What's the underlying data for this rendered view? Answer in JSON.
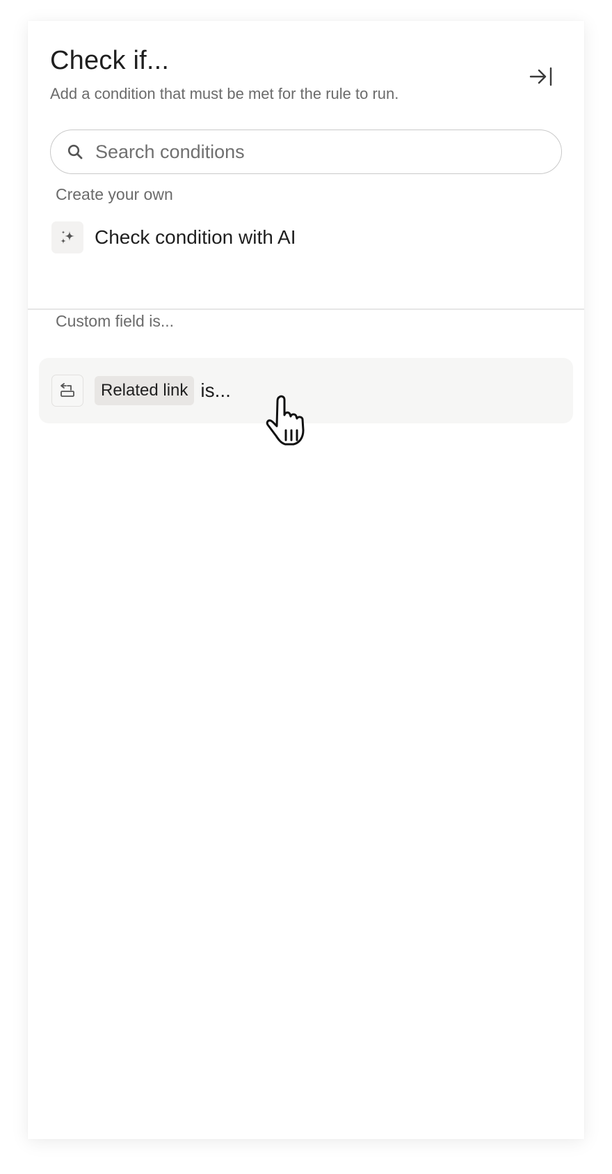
{
  "header": {
    "title": "Check if...",
    "subtitle": "Add a condition that must be met for the rule to run.",
    "collapse_icon": "collapse-right-icon"
  },
  "search": {
    "placeholder": "Search conditions",
    "value": "",
    "icon": "search-icon"
  },
  "create_section": {
    "label": "Create your own",
    "items": [
      {
        "icon": "sparkle-icon",
        "label": "Check condition with AI"
      }
    ]
  },
  "custom_field_section": {
    "label": "Custom field is...",
    "items": [
      {
        "icon": "related-link-field-icon",
        "tag": "Related link",
        "suffix": "is..."
      }
    ]
  },
  "colors": {
    "text": "#1f1f1f",
    "muted": "#6b6b6b",
    "hover_bg": "#f6f6f5",
    "tag_bg": "#e8e6e4"
  }
}
